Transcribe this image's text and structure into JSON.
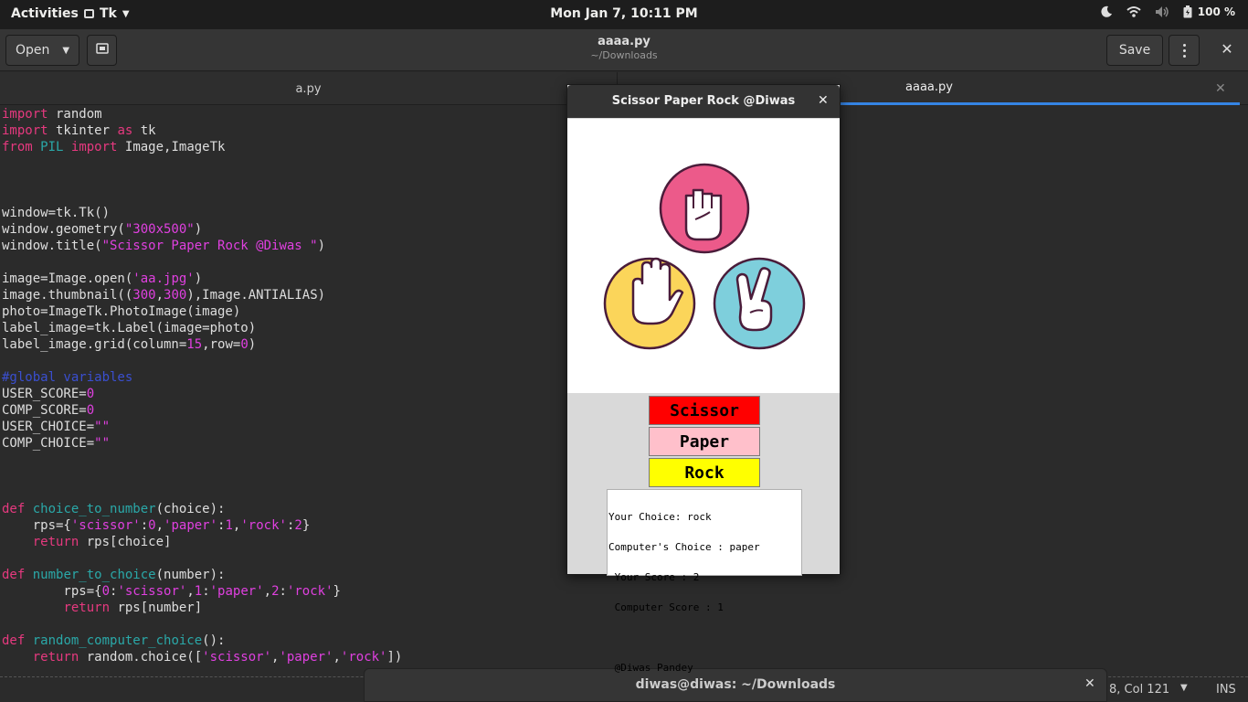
{
  "topbar": {
    "activities": "Activities",
    "app_name": "Tk",
    "clock": "Mon Jan  7, 10:11 PM",
    "battery": "100 %"
  },
  "header": {
    "open_label": "Open",
    "save_label": "Save",
    "title": "aaaa.py",
    "subtitle": "~/Downloads"
  },
  "tabs": [
    {
      "label": "a.py"
    },
    {
      "label": "aaaa.py"
    }
  ],
  "code_lines": [
    [
      [
        "kw",
        "import"
      ],
      [
        "t",
        " random"
      ]
    ],
    [
      [
        "kw",
        "import"
      ],
      [
        "t",
        " tkinter "
      ],
      [
        "kw",
        "as"
      ],
      [
        "t",
        " tk"
      ]
    ],
    [
      [
        "kw",
        "from"
      ],
      [
        "t",
        " "
      ],
      [
        "mod",
        "PIL"
      ],
      [
        "t",
        " "
      ],
      [
        "kw",
        "import"
      ],
      [
        "t",
        " Image,ImageTk"
      ]
    ],
    [],
    [],
    [],
    [
      [
        "t",
        "window=tk.Tk()"
      ]
    ],
    [
      [
        "t",
        "window.geometry("
      ],
      [
        "str",
        "\"300x500\""
      ],
      [
        "t",
        ")"
      ]
    ],
    [
      [
        "t",
        "window.title("
      ],
      [
        "str",
        "\"Scissor Paper Rock @Diwas \""
      ],
      [
        "t",
        ")"
      ]
    ],
    [],
    [
      [
        "t",
        "image=Image.open("
      ],
      [
        "str",
        "'aa.jpg'"
      ],
      [
        "t",
        ")"
      ]
    ],
    [
      [
        "t",
        "image.thumbnail(("
      ],
      [
        "num",
        "300"
      ],
      [
        "t",
        ","
      ],
      [
        "num",
        "300"
      ],
      [
        "t",
        "),Image.ANTIALIAS)"
      ]
    ],
    [
      [
        "t",
        "photo=ImageTk.PhotoImage(image)"
      ]
    ],
    [
      [
        "t",
        "label_image=tk.Label(image=photo)"
      ]
    ],
    [
      [
        "t",
        "label_image.grid(column="
      ],
      [
        "num",
        "15"
      ],
      [
        "t",
        ",row="
      ],
      [
        "num",
        "0"
      ],
      [
        "t",
        ")"
      ]
    ],
    [],
    [
      [
        "cmt",
        "#global variables"
      ]
    ],
    [
      [
        "t",
        "USER_SCORE="
      ],
      [
        "num",
        "0"
      ]
    ],
    [
      [
        "t",
        "COMP_SCORE="
      ],
      [
        "num",
        "0"
      ]
    ],
    [
      [
        "t",
        "USER_CHOICE="
      ],
      [
        "str",
        "\"\""
      ]
    ],
    [
      [
        "t",
        "COMP_CHOICE="
      ],
      [
        "str",
        "\"\""
      ]
    ],
    [],
    [],
    [],
    [
      [
        "kw",
        "def"
      ],
      [
        "t",
        " "
      ],
      [
        "fn",
        "choice_to_number"
      ],
      [
        "t",
        "(choice):"
      ]
    ],
    [
      [
        "t",
        "    rps={"
      ],
      [
        "str",
        "'scissor'"
      ],
      [
        "t",
        ":"
      ],
      [
        "num",
        "0"
      ],
      [
        "t",
        ","
      ],
      [
        "str",
        "'paper'"
      ],
      [
        "t",
        ":"
      ],
      [
        "num",
        "1"
      ],
      [
        "t",
        ","
      ],
      [
        "str",
        "'rock'"
      ],
      [
        "t",
        ":"
      ],
      [
        "num",
        "2"
      ],
      [
        "t",
        "}"
      ]
    ],
    [
      [
        "t",
        "    "
      ],
      [
        "kw",
        "return"
      ],
      [
        "t",
        " rps[choice]"
      ]
    ],
    [],
    [
      [
        "kw",
        "def"
      ],
      [
        "t",
        " "
      ],
      [
        "fn",
        "number_to_choice"
      ],
      [
        "t",
        "(number):"
      ]
    ],
    [
      [
        "t",
        "        rps={"
      ],
      [
        "num",
        "0"
      ],
      [
        "t",
        ":"
      ],
      [
        "str",
        "'scissor'"
      ],
      [
        "t",
        ","
      ],
      [
        "num",
        "1"
      ],
      [
        "t",
        ":"
      ],
      [
        "str",
        "'paper'"
      ],
      [
        "t",
        ","
      ],
      [
        "num",
        "2"
      ],
      [
        "t",
        ":"
      ],
      [
        "str",
        "'rock'"
      ],
      [
        "t",
        "}"
      ]
    ],
    [
      [
        "t",
        "        "
      ],
      [
        "kw",
        "return"
      ],
      [
        "t",
        " rps[number]"
      ]
    ],
    [],
    [
      [
        "kw",
        "def"
      ],
      [
        "t",
        " "
      ],
      [
        "fn",
        "random_computer_choice"
      ],
      [
        "t",
        "():"
      ]
    ],
    [
      [
        "t",
        "    "
      ],
      [
        "kw",
        "return"
      ],
      [
        "t",
        " random.choice(["
      ],
      [
        "str",
        "'scissor'"
      ],
      [
        "t",
        ","
      ],
      [
        "str",
        "'paper'"
      ],
      [
        "t",
        ","
      ],
      [
        "str",
        "'rock'"
      ],
      [
        "t",
        "])"
      ]
    ]
  ],
  "statusbar": {
    "position": "8, Col 121",
    "mode": "INS"
  },
  "terminal_bar": {
    "title": "diwas@diwas: ~/Downloads"
  },
  "tk_window": {
    "title": "Scissor Paper Rock @Diwas",
    "buttons": {
      "scissor": "Scissor",
      "paper": "Paper",
      "rock": "Rock"
    },
    "result_lines": [
      "Your Choice: rock",
      "Computer's Choice : paper",
      " Your Score : 2",
      " Computer Score : 1",
      "",
      " @Diwas Pandey"
    ]
  },
  "colors": {
    "keyword": "#e6397f",
    "string": "#e040e0",
    "function": "#2aa8a8",
    "comment": "#3a4fd0",
    "scissor_bg": "#ff0000",
    "paper_bg": "#ffc0cb",
    "rock_bg": "#ffff00",
    "rock_circle": "#ec5a8a",
    "paper_circle": "#fbd55a",
    "scissor_circle": "#7ecfdc",
    "tab_accent": "#3584e4"
  }
}
